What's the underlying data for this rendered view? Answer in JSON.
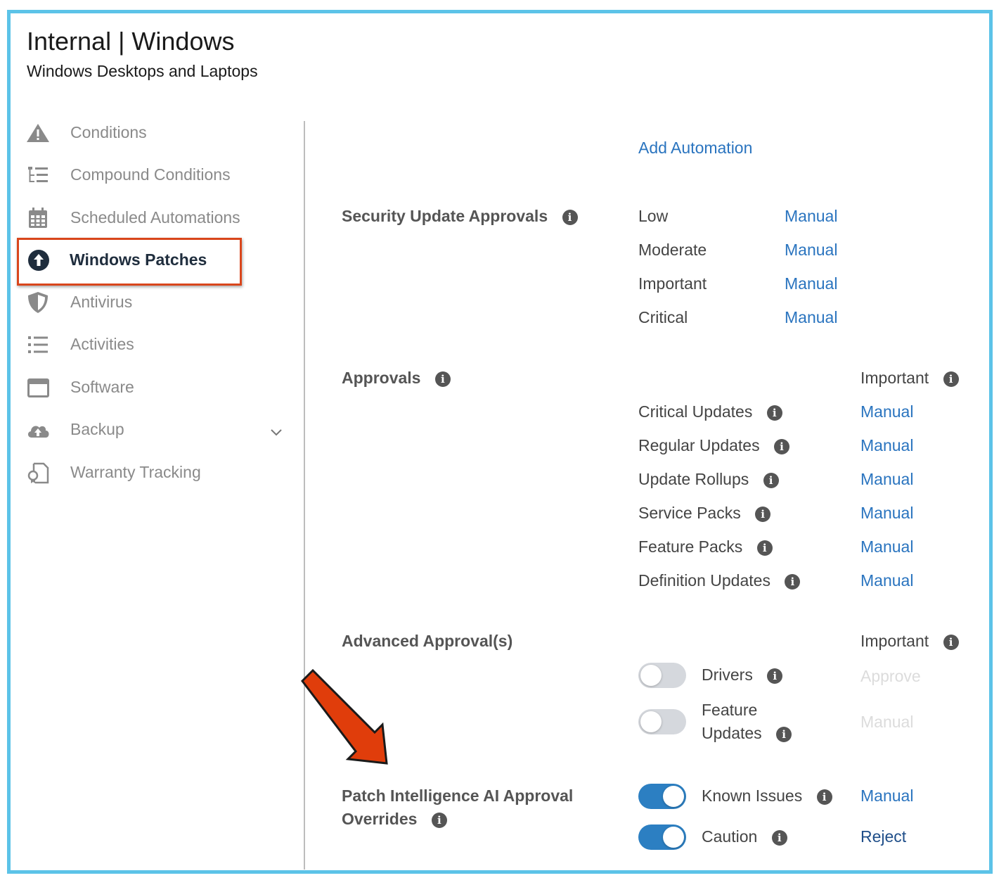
{
  "header": {
    "title": "Internal | Windows",
    "subtitle": "Windows Desktops and Laptops"
  },
  "sidebar": {
    "items": [
      {
        "label": "Conditions",
        "icon": "warning-icon"
      },
      {
        "label": "Compound Conditions",
        "icon": "tree-list-icon"
      },
      {
        "label": "Scheduled Automations",
        "icon": "calendar-icon"
      },
      {
        "label": "Windows Patches",
        "icon": "upload-circle-icon",
        "active": true
      },
      {
        "label": "Antivirus",
        "icon": "shield-icon"
      },
      {
        "label": "Activities",
        "icon": "list-icon"
      },
      {
        "label": "Software",
        "icon": "window-icon"
      },
      {
        "label": "Backup",
        "icon": "cloud-upload-icon",
        "expandable": true
      },
      {
        "label": "Warranty Tracking",
        "icon": "certificate-icon"
      }
    ]
  },
  "main": {
    "add_automation": "Add Automation",
    "security": {
      "title": "Security Update Approvals",
      "rows": [
        {
          "label": "Low",
          "value": "Manual"
        },
        {
          "label": "Moderate",
          "value": "Manual"
        },
        {
          "label": "Important",
          "value": "Manual"
        },
        {
          "label": "Critical",
          "value": "Manual"
        }
      ]
    },
    "approvals": {
      "title": "Approvals",
      "column_header": "Important",
      "rows": [
        {
          "label": "Critical Updates",
          "value": "Manual"
        },
        {
          "label": "Regular Updates",
          "value": "Manual"
        },
        {
          "label": "Update Rollups",
          "value": "Manual"
        },
        {
          "label": "Service Packs",
          "value": "Manual"
        },
        {
          "label": "Feature Packs",
          "value": "Manual"
        },
        {
          "label": "Definition Updates",
          "value": "Manual"
        }
      ]
    },
    "advanced": {
      "title": "Advanced Approval(s)",
      "column_header": "Important",
      "rows": [
        {
          "label": "Drivers",
          "value": "Approve",
          "enabled": false
        },
        {
          "label_line1": "Feature",
          "label_line2": "Updates",
          "value": "Manual",
          "enabled": false
        }
      ]
    },
    "patch_ai": {
      "title_line1": "Patch Intelligence AI Approval",
      "title_line2": "Overrides",
      "rows": [
        {
          "label": "Known Issues",
          "value": "Manual",
          "enabled": true
        },
        {
          "label": "Caution",
          "value": "Reject",
          "enabled": true
        }
      ]
    }
  },
  "colors": {
    "frame": "#5cc3e8",
    "highlight": "#d9461c",
    "link": "#2a74bf",
    "toggle_on": "#2c7fc2",
    "toggle_off": "#d5d8dd"
  }
}
